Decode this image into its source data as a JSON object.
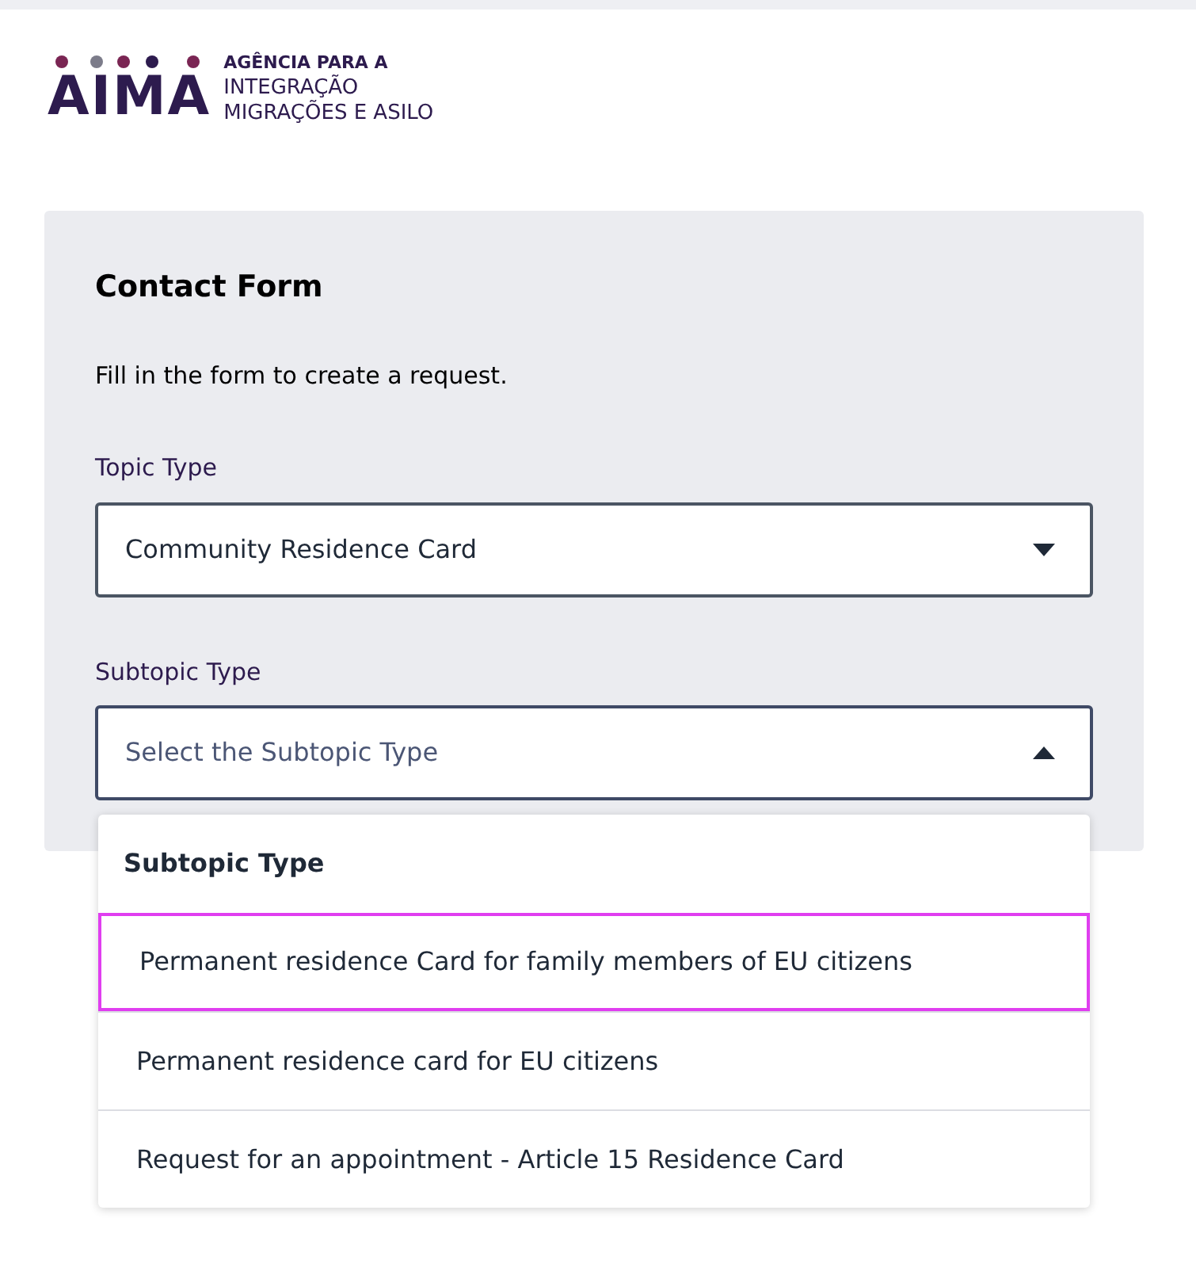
{
  "logo": {
    "mark": "AIMA",
    "lines": [
      "AGÊNCIA PARA A",
      "INTEGRAÇÃO",
      "MIGRAÇÕES E ASILO"
    ]
  },
  "form": {
    "title": "Contact Form",
    "intro": "Fill in the form to create a request.",
    "fields": [
      {
        "label": "Topic Type",
        "value": "Community Residence Card",
        "expanded": false
      },
      {
        "label": "Subtopic Type",
        "placeholder": "Select the Subtopic Type",
        "expanded": true
      }
    ]
  },
  "dropdown": {
    "header": "Subtopic Type",
    "options": [
      {
        "label": "Permanent residence Card for family members of EU citizens",
        "selected": true
      },
      {
        "label": "Permanent residence card for EU citizens",
        "selected": false
      },
      {
        "label": "Request for an appointment - Article 15 Residence Card",
        "selected": false
      }
    ]
  }
}
